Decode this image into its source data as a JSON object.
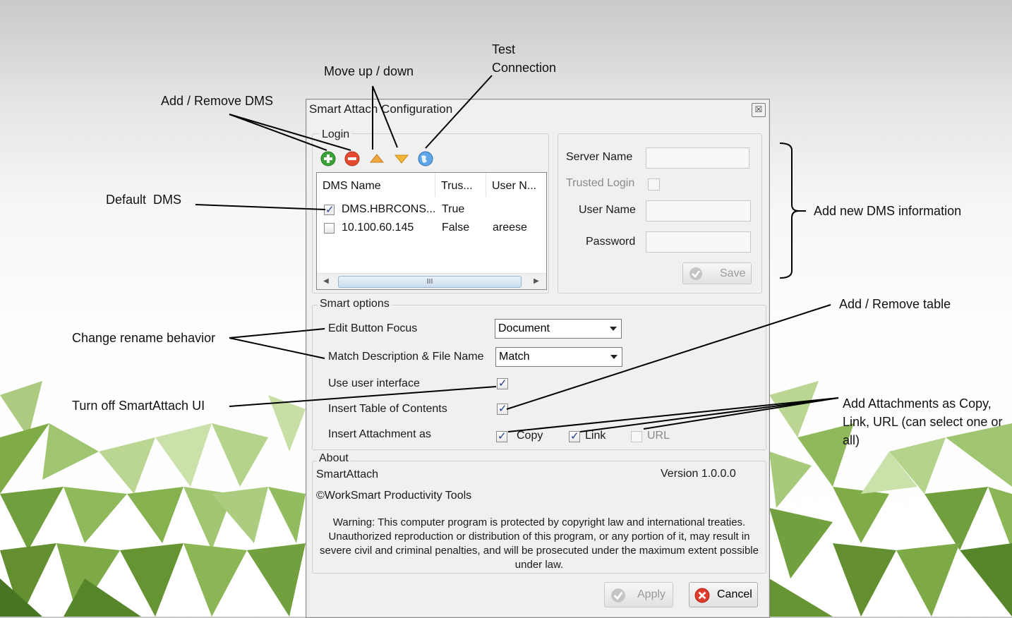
{
  "annotations": {
    "add_remove_dms": "Add / Remove DMS",
    "move_up_down": "Move up / down",
    "test_connection": "Test\nConnection",
    "default_dms": "Default  DMS",
    "add_new_dms_info": "Add new DMS information",
    "change_rename": "Change rename behavior",
    "turn_off_ui": "Turn off SmartAttach UI",
    "add_remove_table": "Add / Remove table",
    "add_attachments": "Add Attachments as Copy,\nLink, URL (can select one or\nall)"
  },
  "dialog": {
    "title": "Smart Attach Configuration",
    "close_glyph": "☒",
    "login": {
      "group_label": "Login",
      "toolbar_icons": [
        "add-icon",
        "remove-icon",
        "move-up-icon",
        "move-down-icon",
        "globe-icon"
      ],
      "columns": [
        "DMS Name",
        "Trus...",
        "User N..."
      ],
      "rows": [
        {
          "checked": true,
          "name": "DMS.HBRCONS...",
          "trusted": "True",
          "user": ""
        },
        {
          "checked": false,
          "name": "10.100.60.145",
          "trusted": "False",
          "user": "areese"
        }
      ],
      "scroll_thumb": "III",
      "server_name_label": "Server Name",
      "trusted_login_label": "Trusted Login",
      "user_name_label": "User Name",
      "password_label": "Password",
      "save_label": "Save"
    },
    "smart_options": {
      "group_label": "Smart options",
      "edit_focus_label": "Edit Button Focus",
      "edit_focus_value": "Document",
      "match_label": "Match Description & File Name",
      "match_value": "Match",
      "use_ui_label": "Use user interface",
      "use_ui_checked": true,
      "toc_label": "Insert Table of Contents",
      "toc_checked": true,
      "insert_as_label": "Insert Attachment as",
      "copy_label": "Copy",
      "copy_checked": true,
      "link_label": "Link",
      "link_checked": true,
      "url_label": "URL",
      "url_checked": false
    },
    "about": {
      "group_label": "About",
      "product": "SmartAttach",
      "version": "Version 1.0.0.0",
      "copyright": "©WorkSmart Productivity Tools",
      "warning": "Warning: This computer program is protected by copyright law and international treaties. Unauthorized reproduction or distribution of this program, or any portion of it, may result in severe civil and criminal penalties, and will be prosecuted under the maximum extent possible under law."
    },
    "apply_label": "Apply",
    "cancel_label": "Cancel"
  }
}
